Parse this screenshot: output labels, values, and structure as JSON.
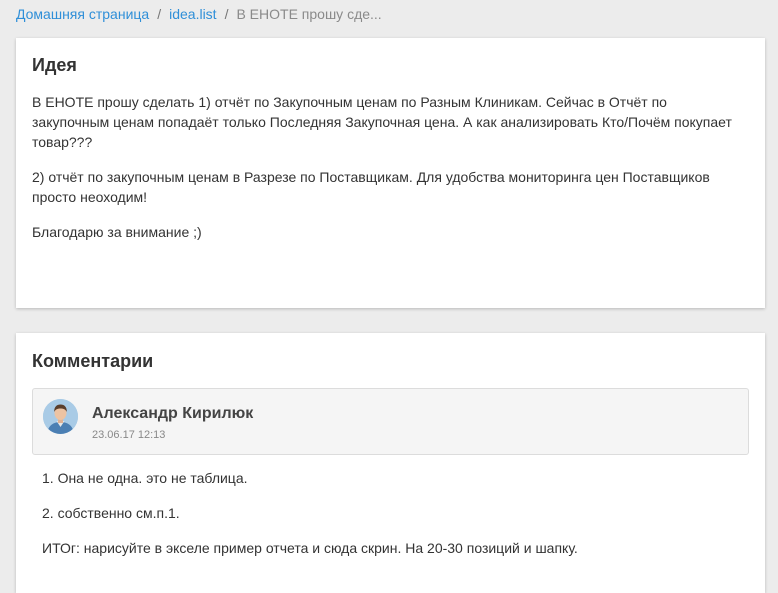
{
  "breadcrumb": {
    "home": "Домашняя страница",
    "list": "idea.list",
    "current": "В ЕНОТЕ прошу сде...",
    "separator": "/"
  },
  "idea": {
    "heading": "Идея",
    "paragraphs": [
      "В ЕНОТЕ прошу сделать 1) отчёт по Закупочным ценам по Разным Клиникам. Сейчас в Отчёт по закупочным ценам попадаёт только Последняя Закупочная цена. А как анализировать Кто/Почём покупает товар???",
      "2) отчёт по закупочным ценам в Разрезе по Поставщикам. Для удобства мониторинга цен Поставщиков просто неоходим!",
      "Благодарю за внимание ;)"
    ]
  },
  "comments": {
    "heading": "Комментарии",
    "items": [
      {
        "author": "Александр Кирилюк",
        "date": "23.06.17 12:13",
        "avatar_icon": "user-avatar-photo",
        "lines": [
          "1. Она не одна. это не таблица.",
          "2. собственно см.п.1.",
          "ИТОг: нарисуйте в экселе пример отчета и сюда скрин. На 20-30 позиций и шапку."
        ]
      }
    ]
  },
  "colors": {
    "link": "#2f8fd8",
    "background": "#ececec",
    "card": "#ffffff"
  }
}
